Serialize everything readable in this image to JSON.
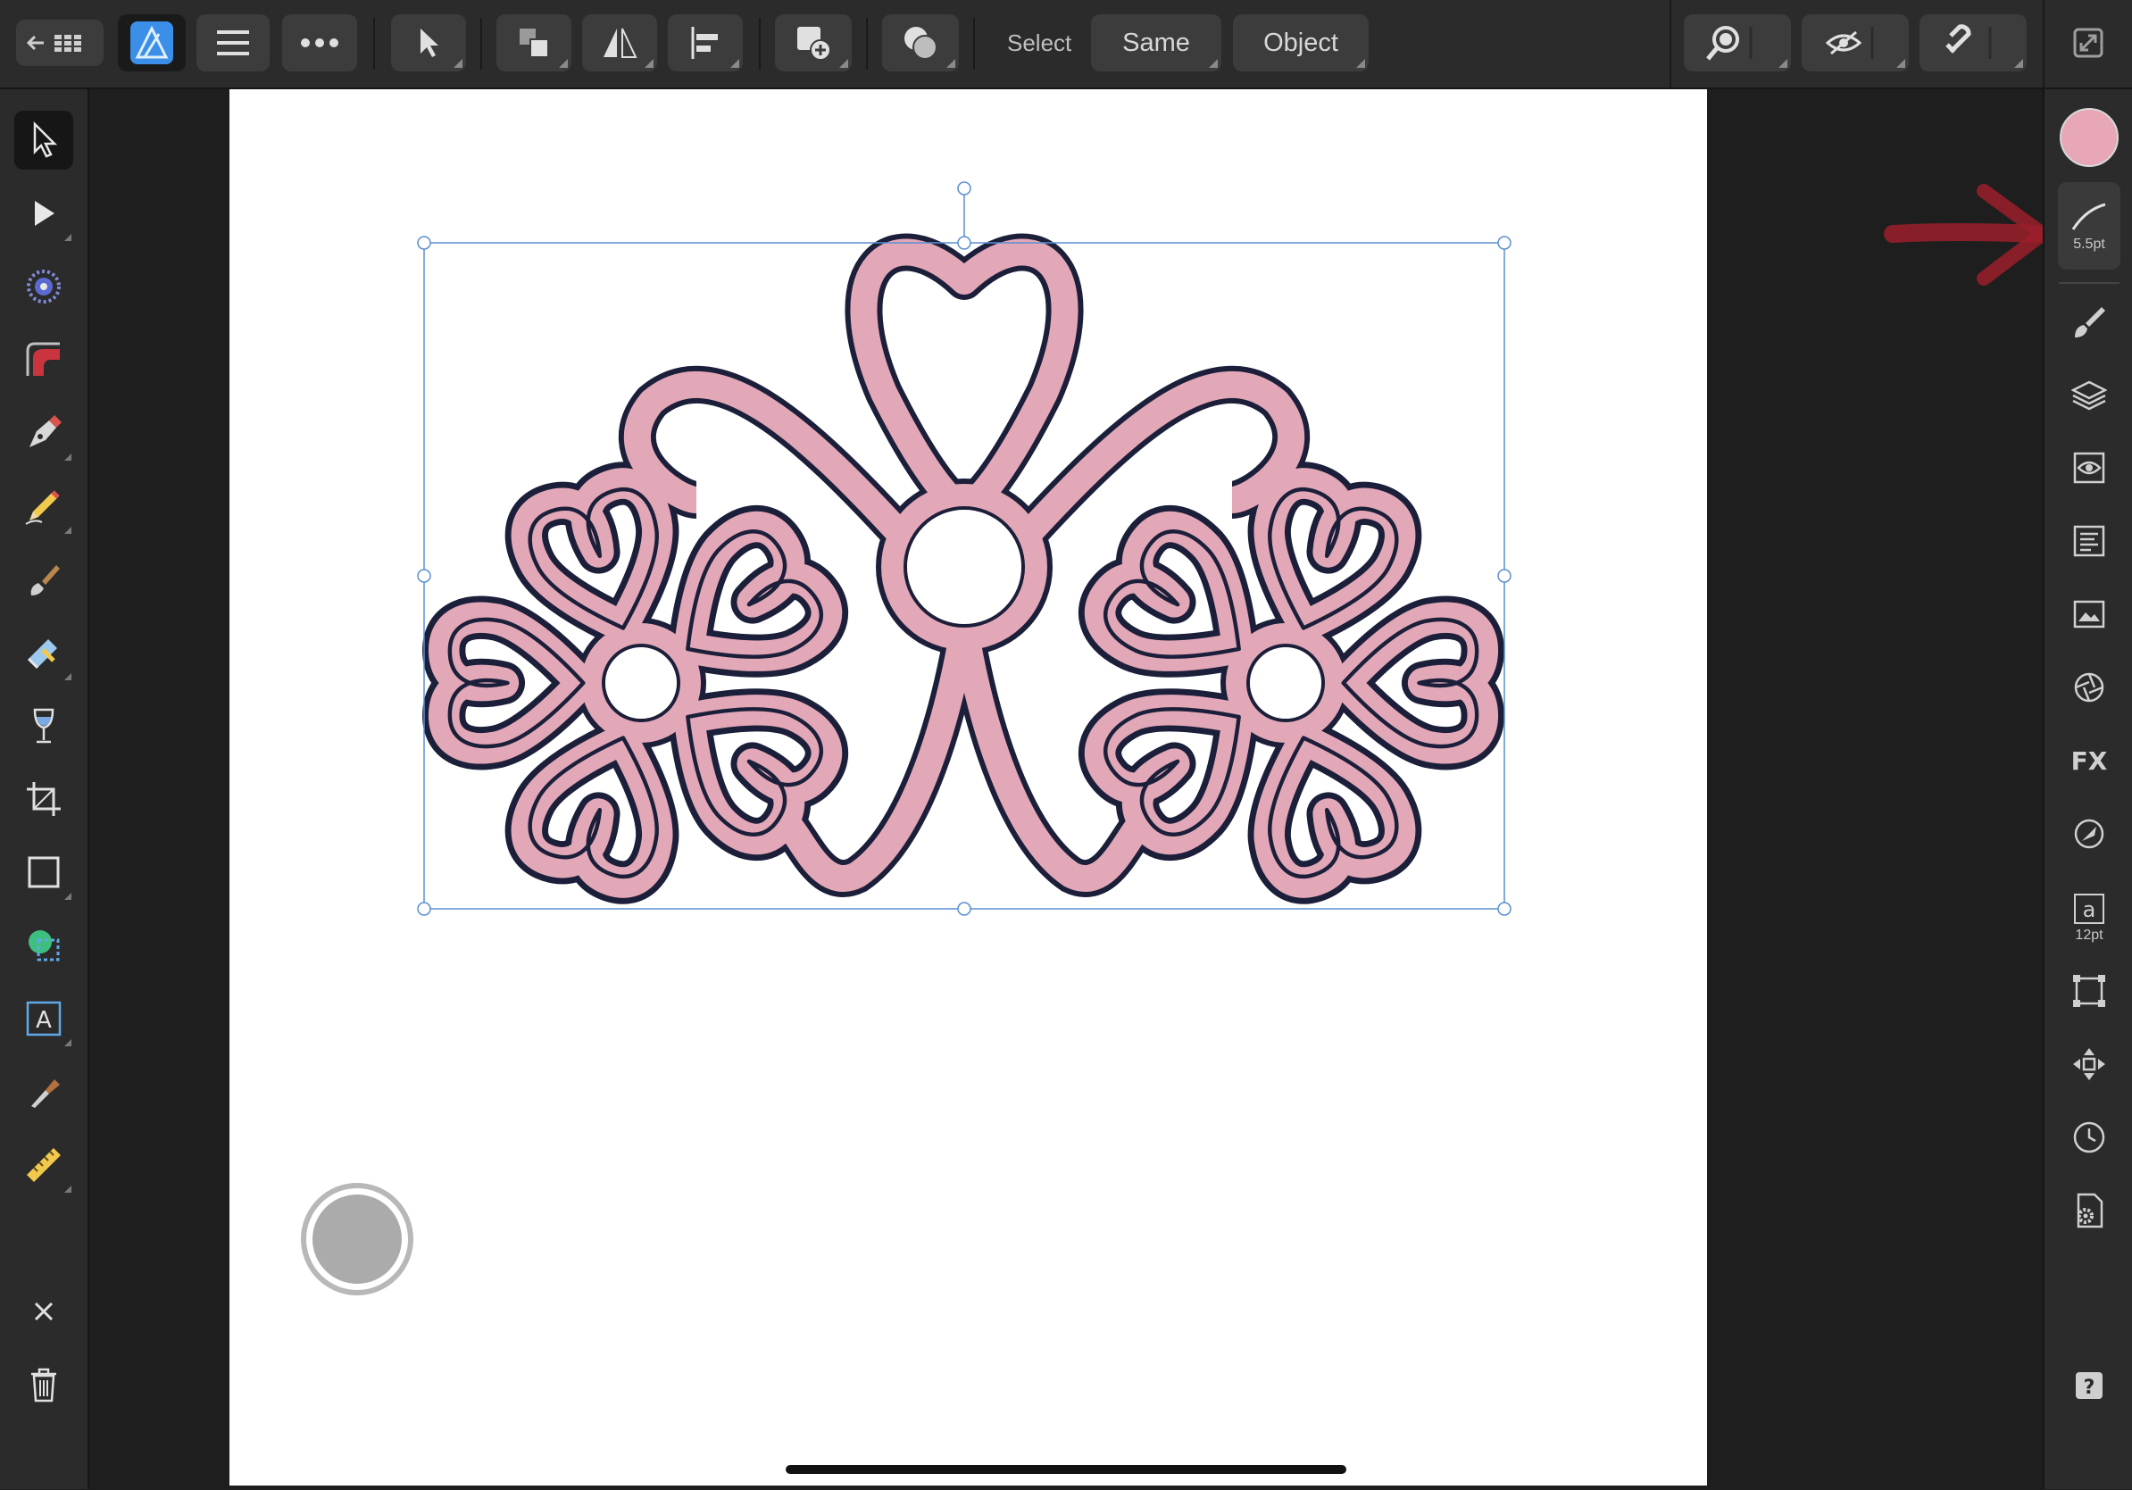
{
  "toolbar": {
    "select_label": "Select",
    "same_label": "Same",
    "object_label": "Object"
  },
  "stroke": {
    "width_label": "5.5pt"
  },
  "text_style": {
    "size_label": "12pt"
  },
  "colors": {
    "fill_swatch": "#e7a7b6",
    "flower_fill": "#e3a8b8",
    "flower_outline": "#1c1f3a",
    "selection": "#5b8fd1",
    "annotation_arrow": "#9a1f2a",
    "app_icon": "#3b8fe8"
  },
  "icons": {
    "top": [
      "back-grid-icon",
      "affinity-designer-logo",
      "hamburger-menu-icon",
      "more-icon",
      "move-tool-icon",
      "arrange-icon",
      "flip-icon",
      "align-icon",
      "add-shape-icon",
      "boolean-icon",
      "zoom-icon",
      "view-mode-icon",
      "snapping-icon",
      "fullscreen-icon"
    ],
    "left": [
      "move-tool-icon",
      "node-tool-icon",
      "point-transform-icon",
      "corner-tool-icon",
      "pen-tool-icon",
      "pencil-tool-icon",
      "vector-brush-icon",
      "fill-tool-icon",
      "transparency-tool-icon",
      "crop-tool-icon",
      "rectangle-tool-icon",
      "shape-builder-icon",
      "text-tool-icon",
      "color-picker-icon",
      "measure-tool-icon",
      "close-icon",
      "delete-icon"
    ],
    "right": [
      "color-swatch",
      "stroke-icon",
      "brushes-icon",
      "layers-icon",
      "appearance-icon",
      "text-styles-icon",
      "assets-icon",
      "stock-icon",
      "symbols-icon",
      "fx-icon",
      "adjustments-icon",
      "text-icon",
      "transform-icon",
      "navigator-icon",
      "history-icon",
      "document-settings-icon",
      "help-icon"
    ]
  }
}
